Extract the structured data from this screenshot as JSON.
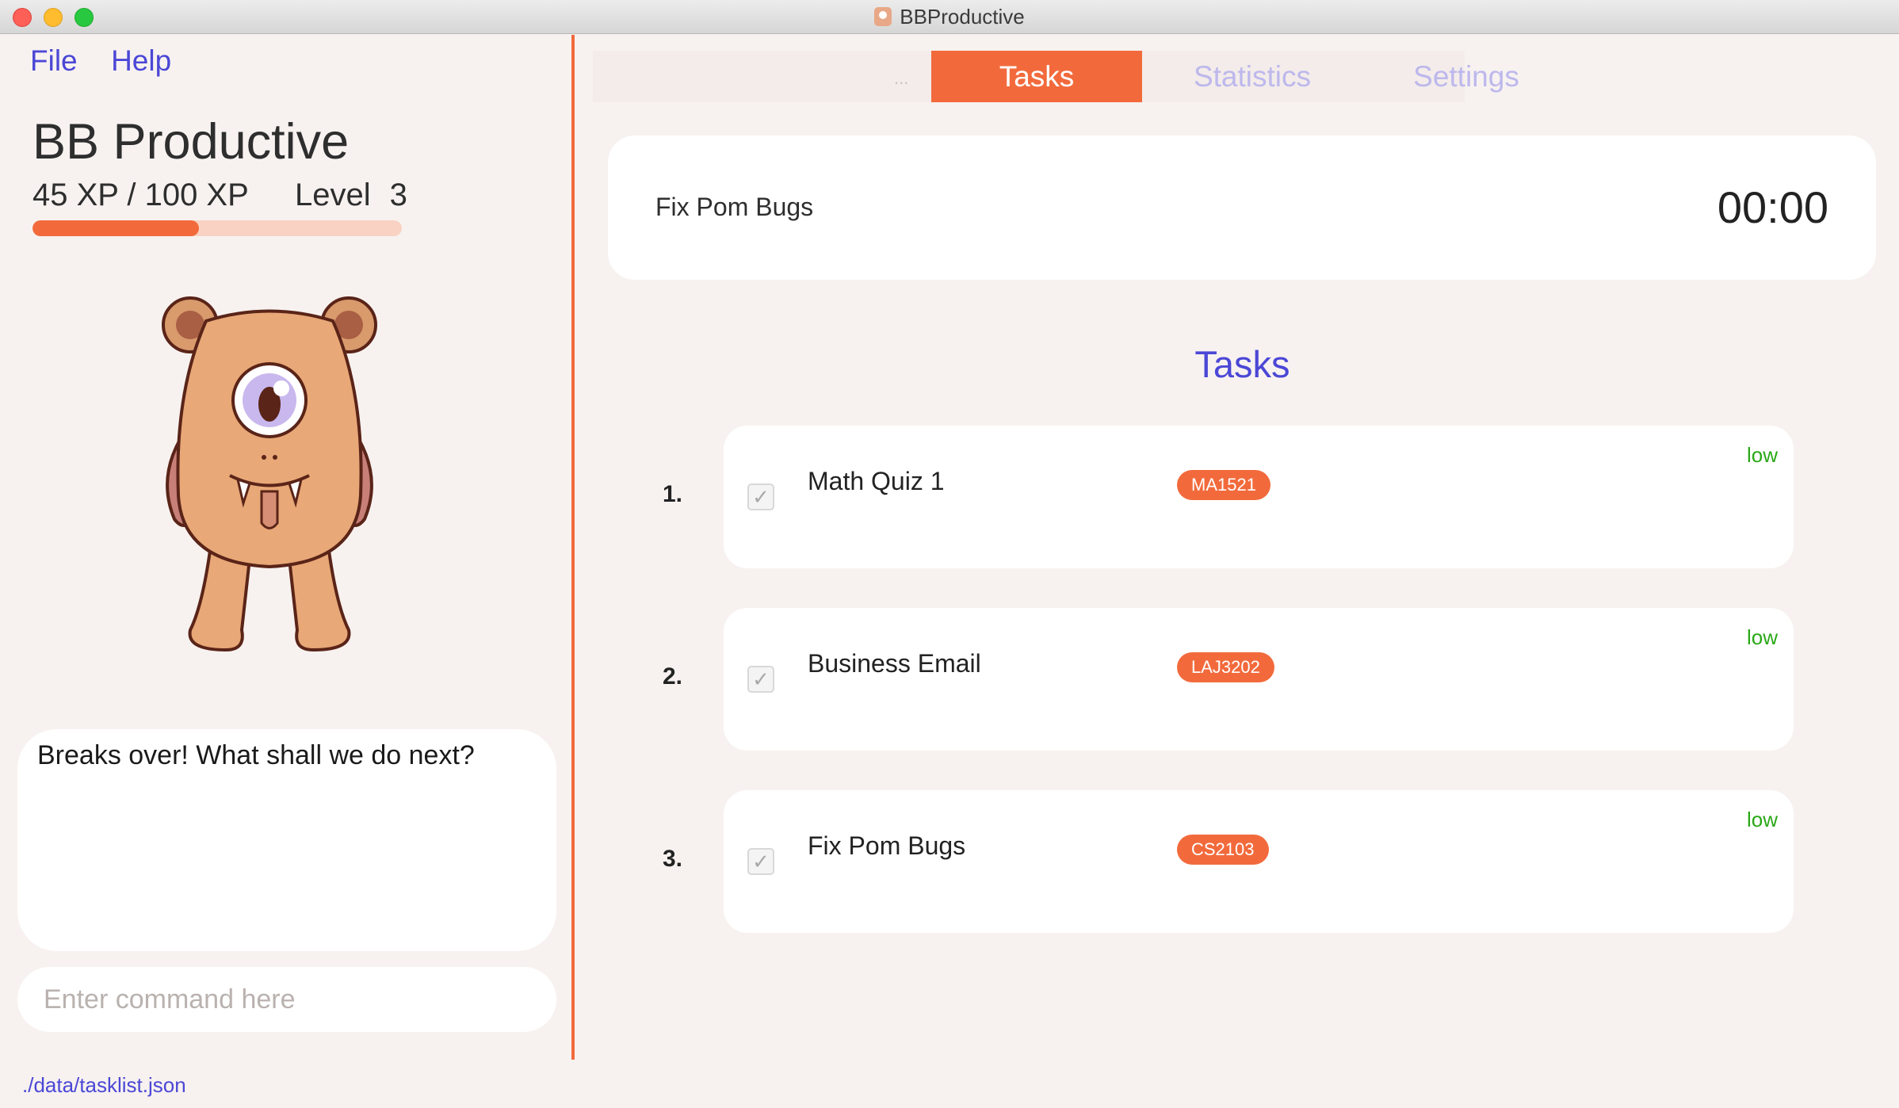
{
  "window": {
    "title": "BBProductive"
  },
  "menu": {
    "file": "File",
    "help": "Help"
  },
  "app": {
    "name": "BB Productive",
    "xp_text": "45 XP / 100 XP",
    "level_label": "Level",
    "level_value": "3",
    "xp_progress": 0.45
  },
  "mascot": {
    "icon": "one-eyed-bear-monster"
  },
  "speech": {
    "text": "Breaks over! What shall we do next?"
  },
  "command": {
    "placeholder": "Enter command here",
    "value": ""
  },
  "status": {
    "path": "./data/tasklist.json"
  },
  "tabs": {
    "dots": "...",
    "items": [
      "Tasks",
      "Statistics",
      "Settings"
    ],
    "active": "Tasks"
  },
  "timer": {
    "task": "Fix Pom Bugs",
    "time": "00:00"
  },
  "tasks_section": {
    "title": "Tasks"
  },
  "tasks": [
    {
      "index": "1.",
      "name": "Math Quiz 1",
      "tag": "MA1521",
      "priority": "low",
      "checked": true
    },
    {
      "index": "2.",
      "name": "Business Email",
      "tag": "LAJ3202",
      "priority": "low",
      "checked": true
    },
    {
      "index": "3.",
      "name": "Fix Pom Bugs",
      "tag": "CS2103",
      "priority": "low",
      "checked": true
    }
  ],
  "colors": {
    "accent": "#f26a3c",
    "link": "#4b47d6",
    "priority_low": "#2aa817",
    "background": "#f7f2f0"
  }
}
